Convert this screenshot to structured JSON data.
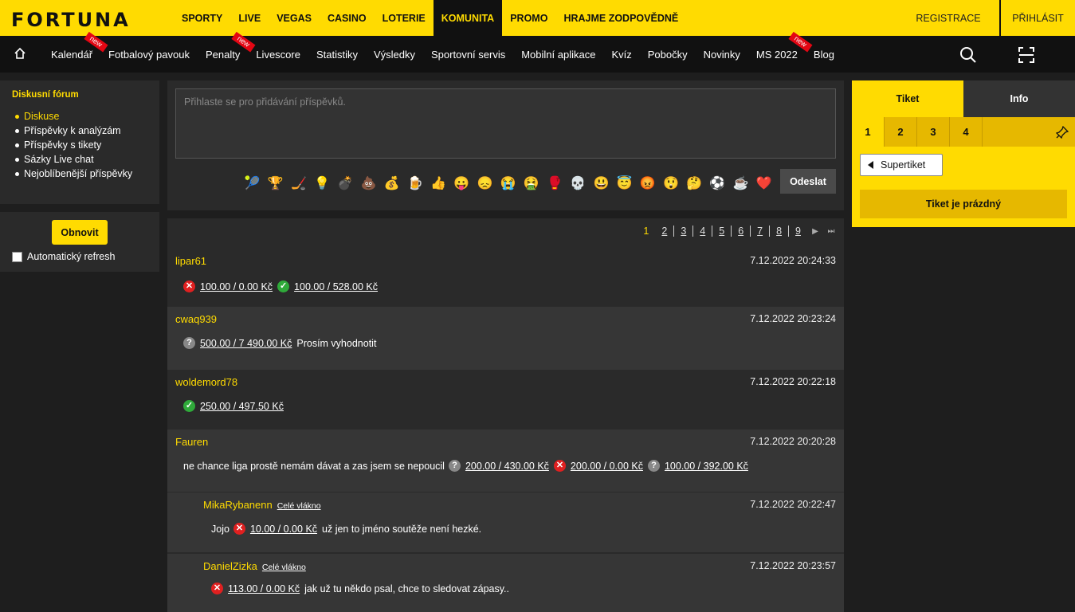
{
  "brand": {
    "logo": "FORTUNA",
    "accent": "#ffdb01"
  },
  "topnav": {
    "items": [
      "SPORTY",
      "LIVE",
      "VEGAS",
      "CASINO",
      "LOTERIE",
      "KOMUNITA",
      "PROMO",
      "HRAJME ZODPOVĚDNĚ"
    ],
    "active": "KOMUNITA",
    "register": "REGISTRACE",
    "login": "PŘIHLÁSIT"
  },
  "subnav": {
    "items": [
      "Kalendář",
      "Fotbalový pavouk",
      "Penalty",
      "Livescore",
      "Statistiky",
      "Výsledky",
      "Sportovní servis",
      "Mobilní aplikace",
      "Kvíz",
      "Pobočky",
      "Novinky",
      "MS 2022",
      "Blog"
    ],
    "new_flag": "new"
  },
  "sidebar": {
    "title": "Diskusní fórum",
    "items": [
      "Diskuse",
      "Příspěvky k analýzám",
      "Příspěvky s tikety",
      "Sázky Live chat",
      "Nejoblíbenější příspěvky"
    ],
    "refresh_button": "Obnovit",
    "auto_refresh_label": "Automatický refresh"
  },
  "composer": {
    "placeholder": "Přihlaste se pro přidávání příspěvků.",
    "emojis": [
      "🎾",
      "🏆",
      "🏒",
      "💡",
      "💣",
      "💩",
      "💰",
      "🍺",
      "👍",
      "😛",
      "😞",
      "😭",
      "🤮",
      "🥊",
      "💀",
      "😃",
      "😇",
      "😡",
      "😲",
      "🤔",
      "⚽",
      "☕",
      "❤️"
    ],
    "send_button": "Odeslat"
  },
  "pager": {
    "pages": [
      "1",
      "2",
      "3",
      "4",
      "5",
      "6",
      "7",
      "8",
      "9"
    ],
    "current": "1"
  },
  "posts": [
    {
      "user": "lipar61",
      "time": "7.12.2022 20:24:33",
      "tickets": [
        {
          "status": "lose",
          "text": "100.00 / 0.00 Kč"
        },
        {
          "status": "win",
          "text": "100.00 / 528.00 Kč"
        }
      ]
    },
    {
      "user": "cwaq939",
      "time": "7.12.2022 20:23:24",
      "tickets": [
        {
          "status": "pend",
          "text": "500.00 / 7 490.00 Kč"
        }
      ],
      "after": "Prosím vyhodnotit"
    },
    {
      "user": "woldemord78",
      "time": "7.12.2022 20:22:18",
      "tickets": [
        {
          "status": "win",
          "text": "250.00 / 497.50 Kč"
        }
      ]
    },
    {
      "user": "Fauren",
      "time": "7.12.2022 20:20:28",
      "before": "ne chance liga prostě nemám dávat a zas jsem se nepoucil",
      "tickets": [
        {
          "status": "pend",
          "text": "200.00 / 430.00 Kč"
        },
        {
          "status": "lose",
          "text": "200.00 / 0.00 Kč"
        },
        {
          "status": "pend",
          "text": "100.00 / 392.00 Kč"
        }
      ]
    },
    {
      "user": "MikaRybanenn",
      "thread": "Celé vlákno",
      "time": "7.12.2022 20:22:47",
      "before": "Jojo",
      "tickets": [
        {
          "status": "lose",
          "text": "10.00 / 0.00 Kč"
        }
      ],
      "after": "už jen to jméno soutěže není hezké."
    },
    {
      "user": "DanielZizka",
      "thread": "Celé vlákno",
      "time": "7.12.2022 20:23:57",
      "tickets": [
        {
          "status": "lose",
          "text": "113.00 / 0.00 Kč"
        }
      ],
      "after": "jak už tu někdo psal, chce to sledovat zápasy.."
    }
  ],
  "ticket_panel": {
    "tabs": [
      "Tiket",
      "Info"
    ],
    "numbers": [
      "1",
      "2",
      "3",
      "4"
    ],
    "supertiket": "Supertiket",
    "empty": "Tiket je prázdný"
  }
}
